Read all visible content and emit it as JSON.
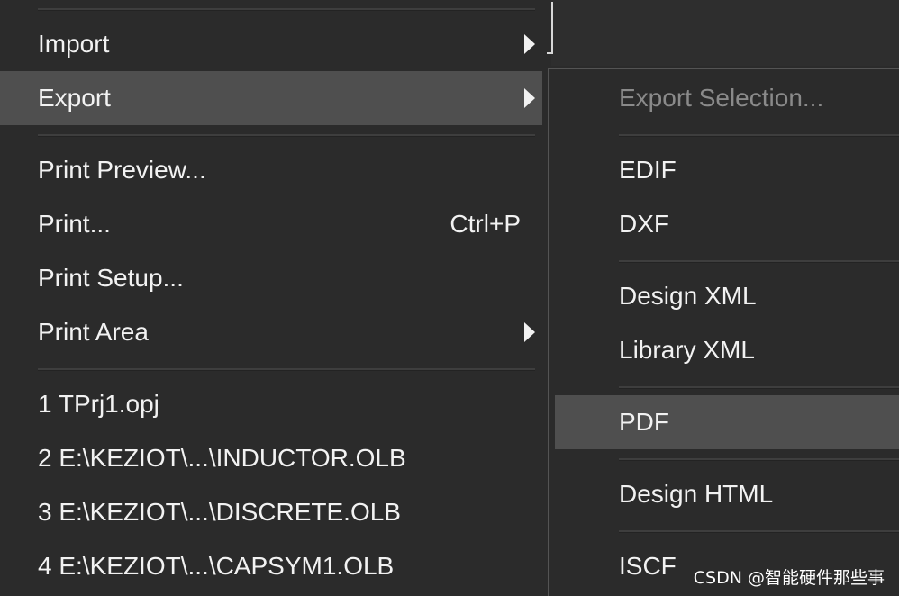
{
  "main_menu": {
    "items": [
      {
        "label": "Import",
        "has_submenu": true
      },
      {
        "label": "Export",
        "has_submenu": true,
        "highlighted": true
      },
      {
        "label": "Print Preview..."
      },
      {
        "label": "Print...",
        "shortcut": "Ctrl+P"
      },
      {
        "label": "Print Setup..."
      },
      {
        "label": "Print Area",
        "has_submenu": true
      },
      {
        "label": "1 TPrj1.opj"
      },
      {
        "label": "2 E:\\KEZIOT\\...\\INDUCTOR.OLB"
      },
      {
        "label": "3 E:\\KEZIOT\\...\\DISCRETE.OLB"
      },
      {
        "label": "4 E:\\KEZIOT\\...\\CAPSYM1.OLB"
      }
    ]
  },
  "export_submenu": {
    "items": [
      {
        "label": "Export Selection...",
        "disabled": true
      },
      {
        "label": "EDIF"
      },
      {
        "label": "DXF"
      },
      {
        "label": "Design XML"
      },
      {
        "label": "Library XML"
      },
      {
        "label": "PDF",
        "highlighted": true
      },
      {
        "label": "Design HTML"
      },
      {
        "label": "ISCF"
      }
    ]
  },
  "watermark": "CSDN @智能硬件那些事",
  "colors": {
    "menu_bg": "#2b2b2b",
    "highlight_bg": "#4f4f4f",
    "text": "#f2f2f2",
    "disabled_text": "#8a8a8a",
    "separator": "#3e3e3e"
  }
}
